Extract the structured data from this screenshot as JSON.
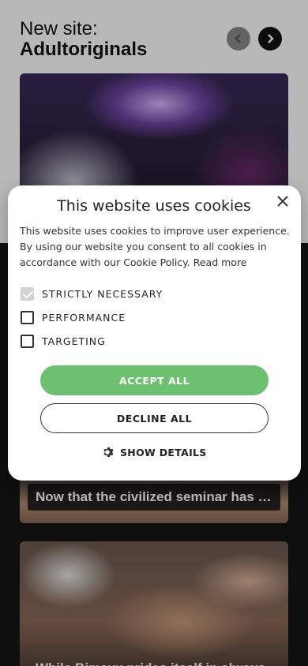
{
  "header": {
    "line1": "New site:",
    "line2": "Adultoriginals"
  },
  "posts": [
    {
      "caption": "Now that the civilized seminar has taken a turn"
    },
    {
      "caption": "While Bimaxx prides itself in always"
    }
  ],
  "cookie_modal": {
    "title": "This website uses cookies",
    "description": "This website uses cookies to improve user experience. By using our website you consent to all cookies in accordance with our Cookie Policy.",
    "read_more": "Read more",
    "options": [
      {
        "label": "STRICTLY NECESSARY",
        "checked": true
      },
      {
        "label": "PERFORMANCE",
        "checked": false
      },
      {
        "label": "TARGETING",
        "checked": false
      }
    ],
    "accept_label": "ACCEPT ALL",
    "decline_label": "DECLINE ALL",
    "details_label": "SHOW DETAILS"
  },
  "colors": {
    "accent": "#6cc070",
    "dark": "#151515"
  }
}
